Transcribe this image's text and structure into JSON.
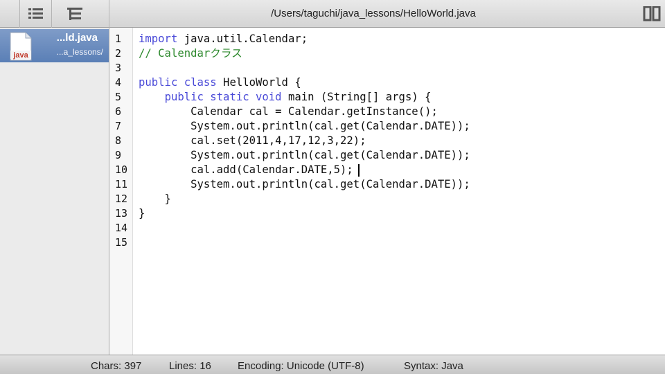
{
  "toolbar": {
    "path_title": "/Users/taguchi/java_lessons/HelloWorld.java",
    "icons": [
      "list-icon",
      "tree-icon",
      "split-view-icon"
    ]
  },
  "sidebar": {
    "documents": [
      {
        "name": "...ld.java",
        "dir": "...a_lessons/",
        "icon_label": "java"
      }
    ]
  },
  "editor": {
    "line_numbers": [
      "1",
      "2",
      "3",
      "4",
      "5",
      "6",
      "7",
      "8",
      "9",
      "10",
      "11",
      "12",
      "13",
      "14",
      "15"
    ],
    "lines": [
      {
        "parts": [
          {
            "t": "import",
            "s": "kw"
          },
          {
            "t": " java.util.Calendar;"
          }
        ]
      },
      {
        "parts": [
          {
            "t": "// Calendarクラス",
            "s": "cm"
          }
        ]
      },
      {
        "parts": []
      },
      {
        "parts": [
          {
            "t": "public class",
            "s": "kw"
          },
          {
            "t": " HelloWorld {"
          }
        ]
      },
      {
        "parts": [
          {
            "t": "    "
          },
          {
            "t": "public static void",
            "s": "kw"
          },
          {
            "t": " main (String[] args) {"
          }
        ]
      },
      {
        "parts": [
          {
            "t": "        Calendar cal = Calendar.getInstance();"
          }
        ]
      },
      {
        "parts": [
          {
            "t": "        System.out.println(cal.get(Calendar.DATE));"
          }
        ]
      },
      {
        "parts": [
          {
            "t": "        cal.set(2011,4,17,12,3,22);"
          }
        ]
      },
      {
        "parts": [
          {
            "t": "        System.out.println(cal.get(Calendar.DATE));"
          }
        ]
      },
      {
        "parts": [
          {
            "t": "        cal.add(Calendar.DATE,5);"
          }
        ]
      },
      {
        "parts": [
          {
            "t": "        System.out.println(cal.get(Calendar.DATE));"
          }
        ]
      },
      {
        "parts": [
          {
            "t": "    }"
          }
        ]
      },
      {
        "parts": [
          {
            "t": "}"
          }
        ]
      },
      {
        "parts": []
      },
      {
        "parts": []
      }
    ]
  },
  "status": {
    "chars": "Chars: 397",
    "lines": "Lines: 16",
    "encoding": "Encoding: Unicode (UTF-8)",
    "syntax": "Syntax: Java"
  },
  "colors": {
    "keyword": "#4a4ad8",
    "comment": "#2f8a2f",
    "selection": "#6f8fc0"
  }
}
